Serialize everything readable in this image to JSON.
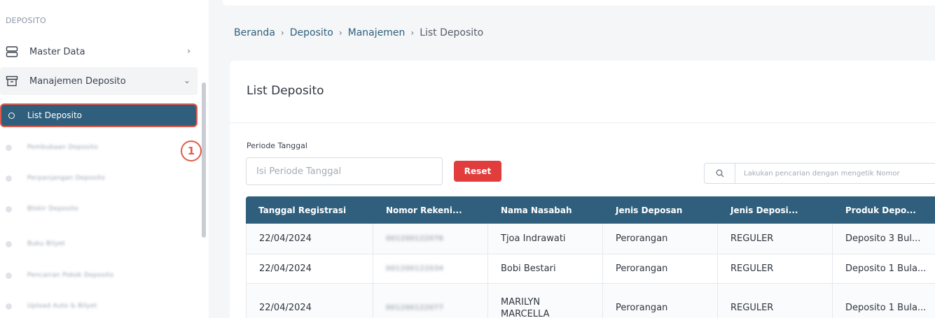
{
  "sidebar": {
    "section_label": "DEPOSITO",
    "items": [
      {
        "label": "Master Data",
        "icon": "server-icon"
      },
      {
        "label": "Manajemen Deposito",
        "icon": "archive-icon"
      }
    ],
    "active_item": "List Deposito",
    "sub_items": [
      {
        "label": "Pembukaan Deposito"
      },
      {
        "label": "Perpanjangan Deposito"
      },
      {
        "label": "Blokir Deposito"
      },
      {
        "label": "Buku Bilyet"
      },
      {
        "label": "Pencairan Pokok Deposito"
      },
      {
        "label": "Upload Auto & Bilyet"
      }
    ],
    "annotation_badge": "1"
  },
  "breadcrumb": {
    "items": [
      "Beranda",
      "Deposito",
      "Manajemen"
    ],
    "current": "List Deposito"
  },
  "main": {
    "title": "List Deposito",
    "period_label": "Periode Tanggal",
    "period_placeholder": "Isi Periode Tanggal",
    "reset_label": "Reset",
    "search_placeholder": "Lakukan pencarian dengan mengetik Nomor"
  },
  "table": {
    "headers": [
      "Tanggal Registrasi",
      "Nomor Rekeni...",
      "Nama Nasabah",
      "Jenis Deposan",
      "Jenis Deposi...",
      "Produk Depo..."
    ],
    "rows": [
      {
        "tanggal": "22/04/2024",
        "nomor": "001200122076",
        "nama": "Tjoa Indrawati",
        "jenis_deposan": "Perorangan",
        "jenis_deposito": "REGULER",
        "produk": "Deposito 3 Bul..."
      },
      {
        "tanggal": "22/04/2024",
        "nomor": "001200122034",
        "nama": "Bobi Bestari",
        "jenis_deposan": "Perorangan",
        "jenis_deposito": "REGULER",
        "produk": "Deposito 1 Bula..."
      },
      {
        "tanggal": "22/04/2024",
        "nomor": "001200122077",
        "nama_line1": "MARILYN",
        "nama_line2": "MARCELLA",
        "jenis_deposan": "Perorangan",
        "jenis_deposito": "REGULER",
        "produk": "Deposito 1 Bula..."
      }
    ]
  },
  "colors": {
    "primary": "#2f5f7c",
    "danger": "#e23d3d",
    "annotation": "#e05b4b"
  }
}
